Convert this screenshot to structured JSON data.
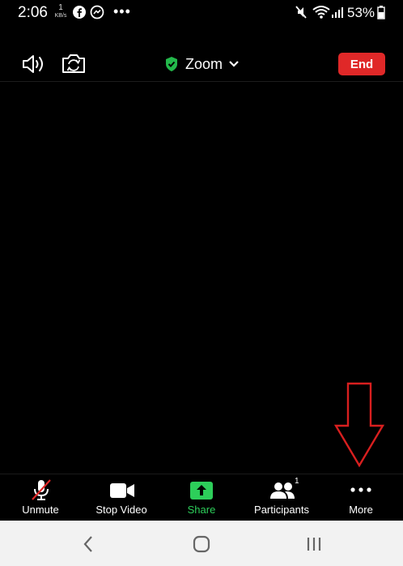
{
  "status_bar": {
    "time": "2:06",
    "net_speed_value": "1",
    "net_speed_unit": "KB/s",
    "overflow_dots": "•••",
    "battery_percent": "53%"
  },
  "meeting": {
    "title": "Zoom",
    "end_label": "End",
    "shield_color": "#23b84b",
    "end_color": "#e02828"
  },
  "toolbar": {
    "items": [
      {
        "label": "Unmute",
        "icon": "mic-muted-icon"
      },
      {
        "label": "Stop Video",
        "icon": "video-camera-icon"
      },
      {
        "label": "Share",
        "icon": "share-icon"
      },
      {
        "label": "Participants",
        "icon": "participants-icon"
      },
      {
        "label": "More",
        "icon": "more-dots-icon"
      }
    ],
    "participant_count": "1",
    "share_color": "#2dce5a"
  },
  "annotation": {
    "icon": "down-arrow-annotation-icon",
    "color": "#e02020"
  },
  "navbar": {
    "buttons": [
      "recent-apps-icon",
      "home-icon",
      "back-icon"
    ]
  }
}
